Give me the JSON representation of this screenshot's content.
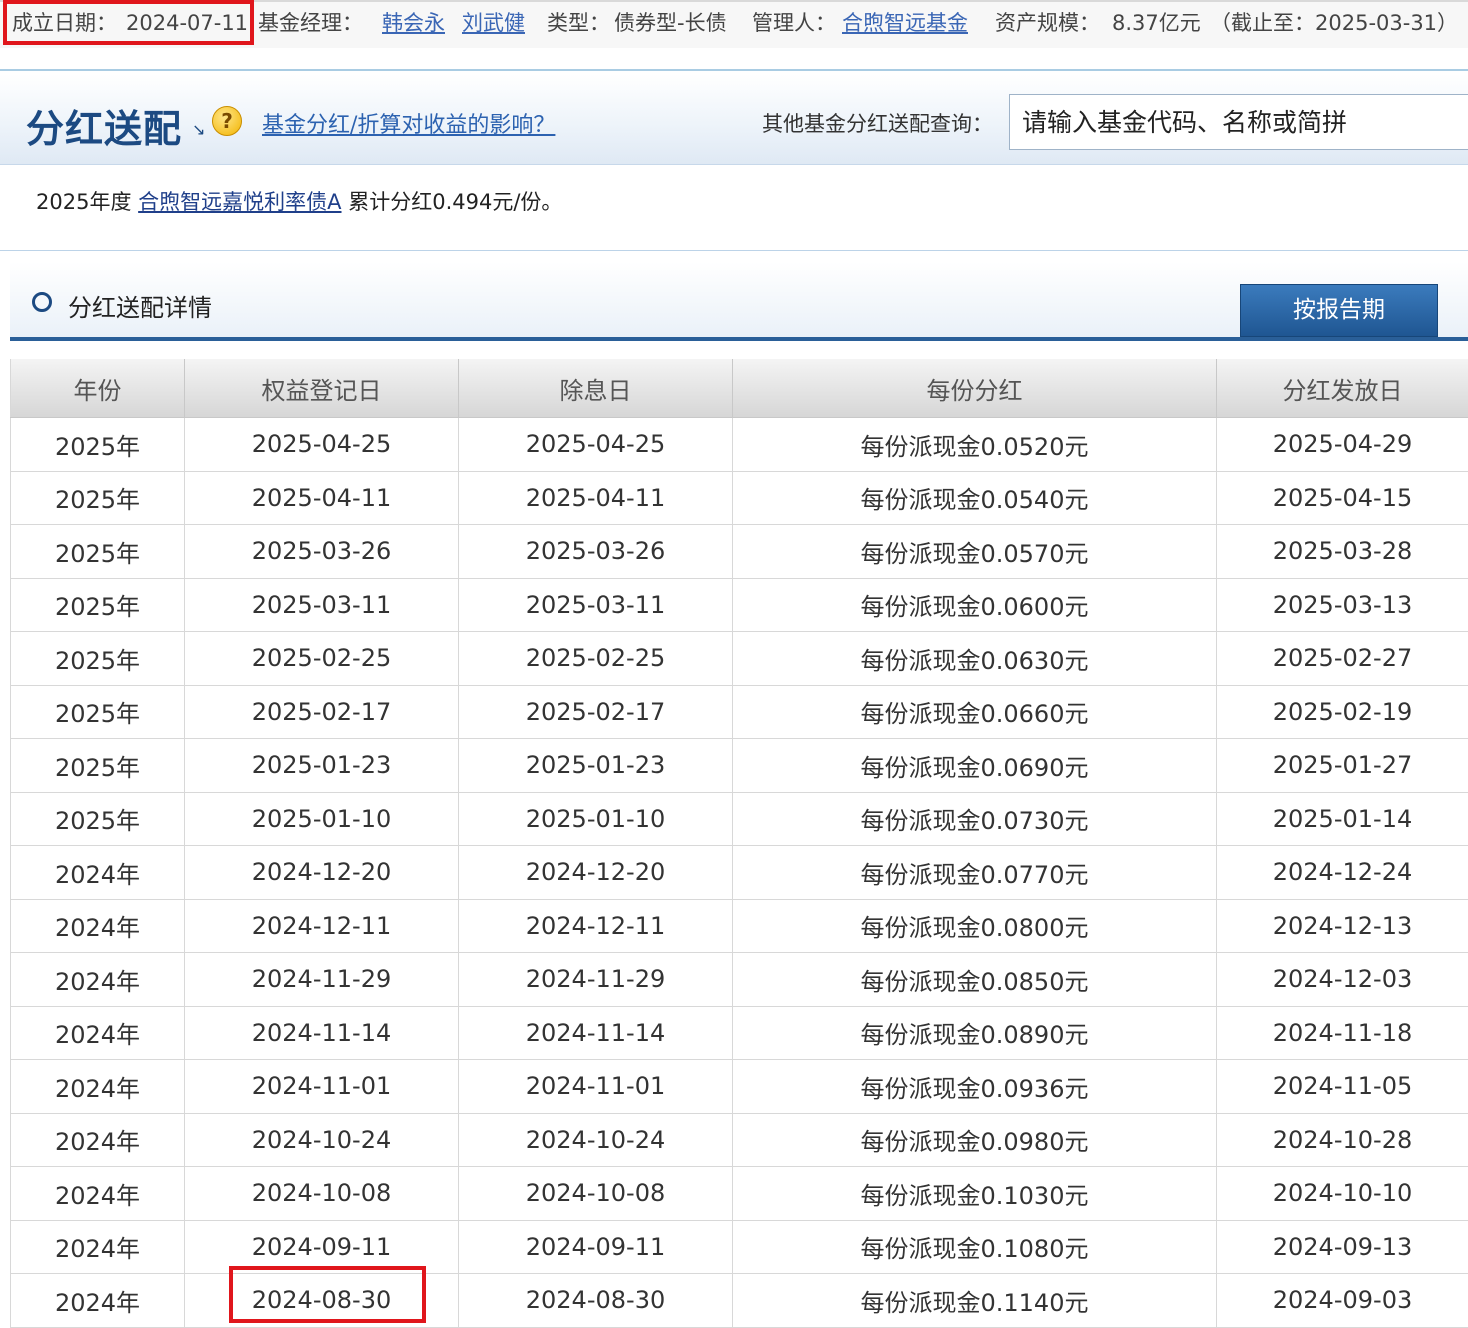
{
  "info_bar": {
    "establish_label": "成立日期：",
    "establish_date": "2024-07-11",
    "manager_label": "基金经理：",
    "managers": [
      "韩会永",
      "刘武健"
    ],
    "type_label": "类型：",
    "type_value": "债券型-长债",
    "custodian_label": "管理人：",
    "custodian": "合煦智远基金",
    "aum_label": "资产规模：",
    "aum_value": "8.37亿元",
    "aum_date": "（截止至：2025-03-31）"
  },
  "header": {
    "title": "分红送配",
    "help_link": "基金分红/折算对收益的影响？",
    "query_label": "其他基金分红送配查询：",
    "query_placeholder": "请输入基金代码、名称或简拼"
  },
  "summary": {
    "year_text": "2025年度",
    "fund_name": "合煦智远嘉悦利率债A",
    "total_text": "累计分红0.494元/份。"
  },
  "detail": {
    "title": "分红送配详情",
    "period_button": "按报告期"
  },
  "table": {
    "headers": [
      "年份",
      "权益登记日",
      "除息日",
      "每份分红",
      "分红发放日"
    ],
    "rows": [
      [
        "2025年",
        "2025-04-25",
        "2025-04-25",
        "每份派现金0.0520元",
        "2025-04-29"
      ],
      [
        "2025年",
        "2025-04-11",
        "2025-04-11",
        "每份派现金0.0540元",
        "2025-04-15"
      ],
      [
        "2025年",
        "2025-03-26",
        "2025-03-26",
        "每份派现金0.0570元",
        "2025-03-28"
      ],
      [
        "2025年",
        "2025-03-11",
        "2025-03-11",
        "每份派现金0.0600元",
        "2025-03-13"
      ],
      [
        "2025年",
        "2025-02-25",
        "2025-02-25",
        "每份派现金0.0630元",
        "2025-02-27"
      ],
      [
        "2025年",
        "2025-02-17",
        "2025-02-17",
        "每份派现金0.0660元",
        "2025-02-19"
      ],
      [
        "2025年",
        "2025-01-23",
        "2025-01-23",
        "每份派现金0.0690元",
        "2025-01-27"
      ],
      [
        "2025年",
        "2025-01-10",
        "2025-01-10",
        "每份派现金0.0730元",
        "2025-01-14"
      ],
      [
        "2024年",
        "2024-12-20",
        "2024-12-20",
        "每份派现金0.0770元",
        "2024-12-24"
      ],
      [
        "2024年",
        "2024-12-11",
        "2024-12-11",
        "每份派现金0.0800元",
        "2024-12-13"
      ],
      [
        "2024年",
        "2024-11-29",
        "2024-11-29",
        "每份派现金0.0850元",
        "2024-12-03"
      ],
      [
        "2024年",
        "2024-11-14",
        "2024-11-14",
        "每份派现金0.0890元",
        "2024-11-18"
      ],
      [
        "2024年",
        "2024-11-01",
        "2024-11-01",
        "每份派现金0.0936元",
        "2024-11-05"
      ],
      [
        "2024年",
        "2024-10-24",
        "2024-10-24",
        "每份派现金0.0980元",
        "2024-10-28"
      ],
      [
        "2024年",
        "2024-10-08",
        "2024-10-08",
        "每份派现金0.1030元",
        "2024-10-10"
      ],
      [
        "2024年",
        "2024-09-11",
        "2024-09-11",
        "每份派现金0.1080元",
        "2024-09-13"
      ],
      [
        "2024年",
        "2024-08-30",
        "2024-08-30",
        "每份派现金0.1140元",
        "2024-09-03"
      ]
    ]
  },
  "colors": {
    "highlight_box": "#e0161c",
    "title_blue": "#1c4a82",
    "button_blue": "#2a5f98"
  }
}
